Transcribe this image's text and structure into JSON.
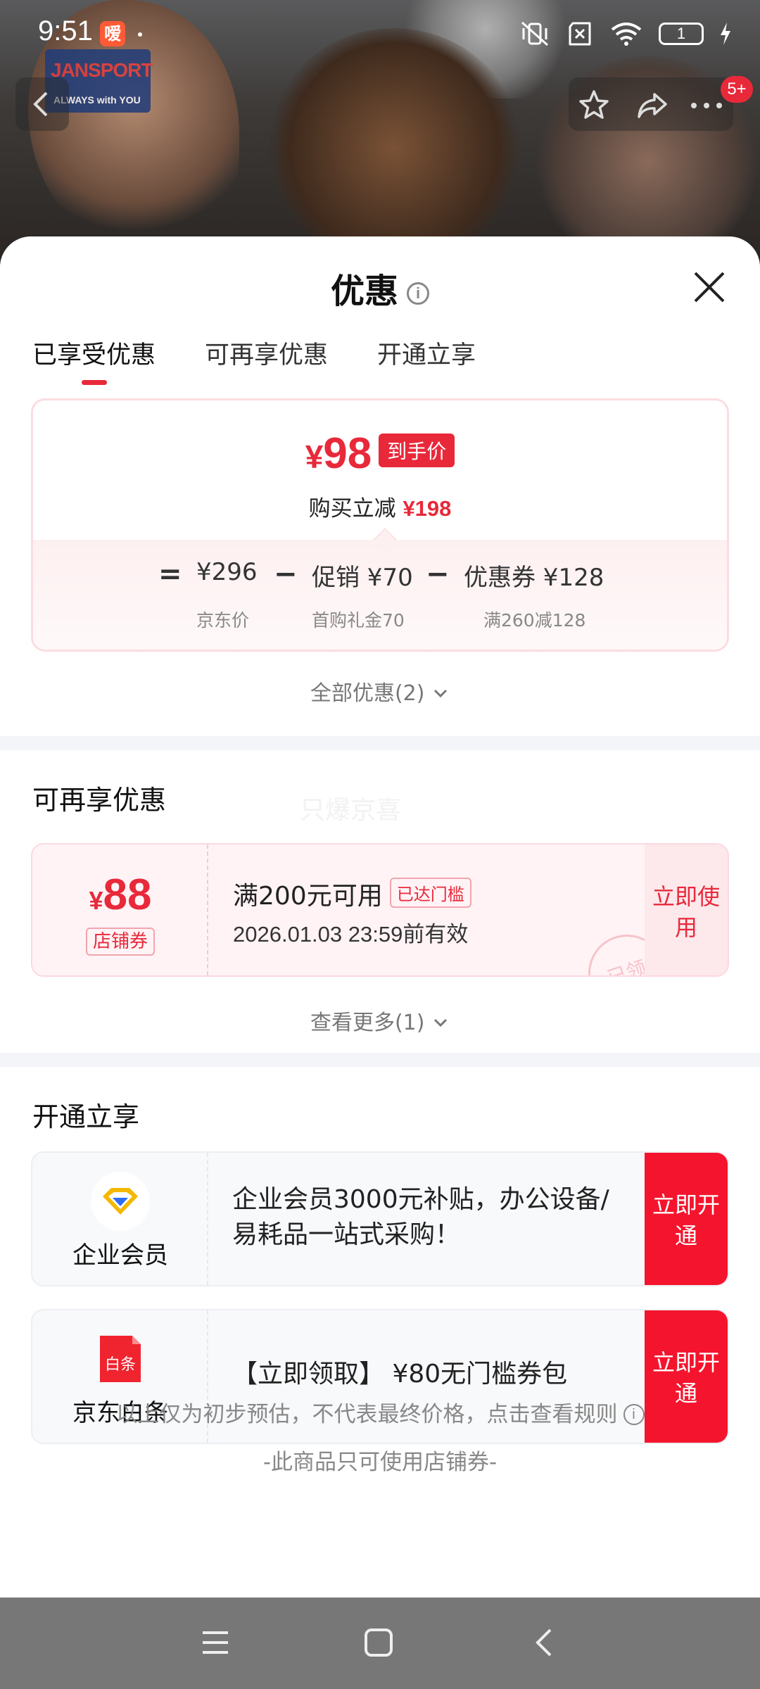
{
  "status_bar": {
    "time": "9:51",
    "app_badge": "嗳",
    "battery": "1"
  },
  "nav": {
    "more_badge": "5+"
  },
  "photo": {
    "brand": "JANSPORT",
    "tagline": "ALWAYS with YOU"
  },
  "sheet": {
    "title": "优惠",
    "tabs": [
      "已享受优惠",
      "可再享优惠",
      "开通立享"
    ],
    "price_card": {
      "currency": "¥",
      "final_price": "98",
      "final_tag": "到手价",
      "saving_prefix": "购买立减",
      "saving_amount": "¥198",
      "eq": "=",
      "jd_price": "¥296",
      "minus1": "−",
      "promo": "促销 ¥70",
      "minus2": "−",
      "coupon": "优惠券 ¥128",
      "jd_price_label": "京东价",
      "promo_label": "首购礼金70",
      "coupon_label": "满260减128"
    },
    "all_promos": "全部优惠(2)"
  },
  "section_more": {
    "title": "可再享优惠",
    "watermark": "只爆京喜",
    "coupon": {
      "currency": "¥",
      "amount": "88",
      "kind": "店铺券",
      "condition": "满200元可用",
      "reached": "已达门槛",
      "valid": "2026.01.03 23:59前有效",
      "use_button": "立即使用",
      "stamp": "已领"
    },
    "see_more": "查看更多(1)"
  },
  "section_open": {
    "title": "开通立享",
    "cards": [
      {
        "name": "企业会员",
        "desc": "企业会员3000元补贴，办公设备/易耗品一站式采购！",
        "button": "立即开通"
      },
      {
        "name": "京东白条",
        "logo_text": "白条",
        "desc": "【立即领取】 ¥80无门槛券包",
        "button": "立即开通"
      }
    ],
    "disclaimer": "以上仅为初步预估，不代表最终价格，点击查看规则",
    "note": "-此商品只可使用店铺券-"
  },
  "colors": {
    "accent": "#e8293a",
    "button_red": "#f5142d"
  }
}
